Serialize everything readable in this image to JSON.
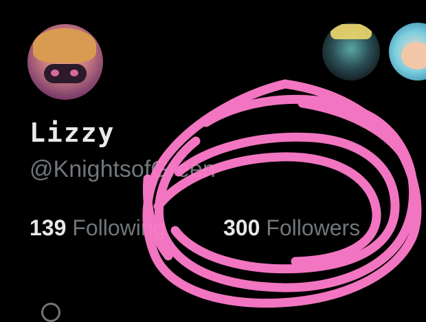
{
  "profile": {
    "display_name": "Lizzy",
    "handle": "@KnightsofGreen"
  },
  "stats": {
    "following": {
      "count": "139",
      "label": "Following"
    },
    "followers": {
      "count": "300",
      "label": "Followers"
    }
  },
  "colors": {
    "background": "#000000",
    "primary_text": "#e7e9ea",
    "secondary_text": "#71767b",
    "annotation": "#ff7ccc"
  }
}
